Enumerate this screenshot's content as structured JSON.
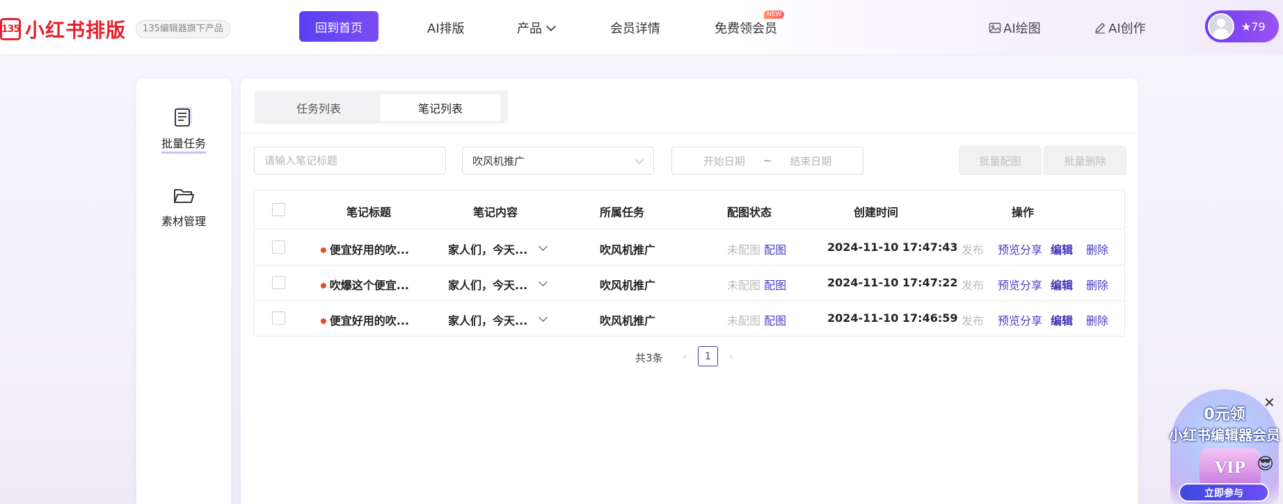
{
  "header": {
    "logo_badge": "135",
    "logo_text": "小红书排版",
    "logo_tag": "135编辑器旗下产品",
    "nav": {
      "home": "回到首页",
      "ai_layout": "AI排版",
      "product": "产品",
      "member": "会员详情",
      "free_member": "免费领会员",
      "new_badge": "NEW"
    },
    "tools": {
      "ai_draw": "AI绘图",
      "ai_create": "AI创作"
    },
    "user": {
      "stars": "★79"
    }
  },
  "sidebar": {
    "items": [
      {
        "label": "批量任务",
        "active": true
      },
      {
        "label": "素材管理",
        "active": false
      }
    ]
  },
  "tabs": [
    {
      "label": "任务列表",
      "active": false
    },
    {
      "label": "笔记列表",
      "active": true
    }
  ],
  "filters": {
    "title_placeholder": "请输入笔记标题",
    "task_select": "吹风机推广",
    "start_date_placeholder": "开始日期",
    "date_sep": "~",
    "end_date_placeholder": "结束日期",
    "batch_image": "批量配图",
    "batch_delete": "批量删除"
  },
  "table": {
    "headers": {
      "title": "笔记标题",
      "content": "笔记内容",
      "task": "所属任务",
      "image_status": "配图状态",
      "created": "创建时间",
      "actions": "操作"
    },
    "rows": [
      {
        "title": "便宜好用的吹...",
        "content": "家人们，今天...",
        "task": "吹风机推广",
        "status": "未配图",
        "status_action": "配图",
        "created": "2024-11-10 17:47:43"
      },
      {
        "title": "吹爆这个便宜...",
        "content": "家人们，今天...",
        "task": "吹风机推广",
        "status": "未配图",
        "status_action": "配图",
        "created": "2024-11-10 17:47:22"
      },
      {
        "title": "便宜好用的吹...",
        "content": "家人们，今天...",
        "task": "吹风机推广",
        "status": "未配图",
        "status_action": "配图",
        "created": "2024-11-10 17:46:59"
      }
    ],
    "row_actions": {
      "publish": "发布",
      "preview_share": "预览分享",
      "edit": "编辑",
      "delete": "删除"
    }
  },
  "pagination": {
    "total": "共3条",
    "current_page": "1",
    "prev": "‹",
    "next": "›"
  },
  "promo": {
    "line1": "0元领",
    "line2": "小红书编辑器会员",
    "vip": "VIP",
    "cta": "立即参与",
    "close": "✕"
  }
}
